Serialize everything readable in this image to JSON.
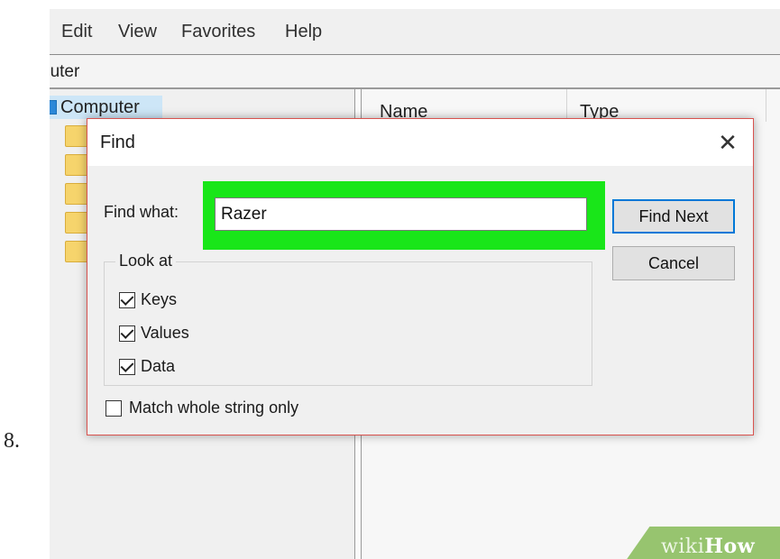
{
  "step_number": "8.",
  "menu": [
    "Edit",
    "View",
    "Favorites",
    "Help"
  ],
  "address": "puter",
  "tree": {
    "root_label": "Computer"
  },
  "list_columns": [
    "Name",
    "Type"
  ],
  "dialog": {
    "title": "Find",
    "close_icon": "close-icon",
    "find_label": "Find what:",
    "find_value": "Razer",
    "find_next_label": "Find Next",
    "cancel_label": "Cancel",
    "look_at_label": "Look at",
    "options": [
      {
        "label": "Keys",
        "checked": true
      },
      {
        "label": "Values",
        "checked": true
      },
      {
        "label": "Data",
        "checked": true
      }
    ],
    "match_whole": {
      "label": "Match whole string only",
      "checked": false
    },
    "highlight_color": "#19e619",
    "border_color": "#d9534f",
    "button_focus_color": "#0078d7"
  },
  "watermark": {
    "part1": "wiki",
    "part2": "How"
  }
}
